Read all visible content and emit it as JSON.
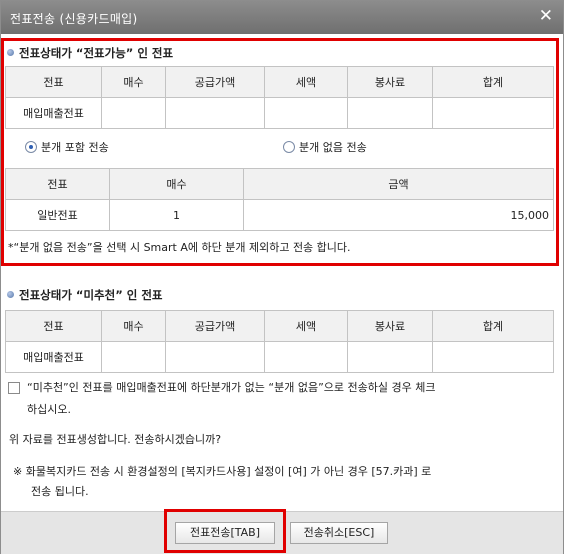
{
  "window": {
    "title": "전표전송 (신용카드매입)",
    "close_glyph": "✕"
  },
  "section1": {
    "heading": "전표상태가 “전표가능” 인 전표",
    "table1": {
      "headers": [
        "전표",
        "매수",
        "공급가액",
        "세액",
        "봉사료",
        "합계"
      ],
      "row": [
        "매입매출전표",
        "",
        "",
        "",
        "",
        ""
      ]
    },
    "radio_include": "분개 포함 전송",
    "radio_exclude": "분개 없음 전송",
    "table2": {
      "headers": [
        "전표",
        "매수",
        "금액"
      ],
      "row": [
        "일반전표",
        "1",
        "15,000"
      ]
    },
    "note": "*“분개 없음 전송”을 선택 시 Smart A에 하단 분개 제외하고 전송 합니다."
  },
  "section2": {
    "heading": "전표상태가 “미추천” 인 전표",
    "table": {
      "headers": [
        "전표",
        "매수",
        "공급가액",
        "세액",
        "봉사료",
        "합계"
      ],
      "row": [
        "매입매출전표",
        "",
        "",
        "",
        "",
        ""
      ]
    },
    "checkbox_line1": "“미추천”인 전표를 매입매출전표에 하단분개가 없는 “분개 없음”으로 전송하실 경우 체크",
    "checkbox_line2": "하십시오."
  },
  "confirm_text": "위 자료를 전표생성합니다. 전송하시겠습니까?",
  "info_line1": "※ 화물복지카드 전송 시 환경설정의 [복지카드사용] 설정이 [여] 가 아닌 경우 [57.카과] 로",
  "info_line2": "전송 됩니다.",
  "buttons": {
    "send": "전표전송[TAB]",
    "cancel": "전송취소[ESC]"
  },
  "colors": {
    "highlight": "#e00000",
    "titlebar": "#7d7d7d"
  }
}
